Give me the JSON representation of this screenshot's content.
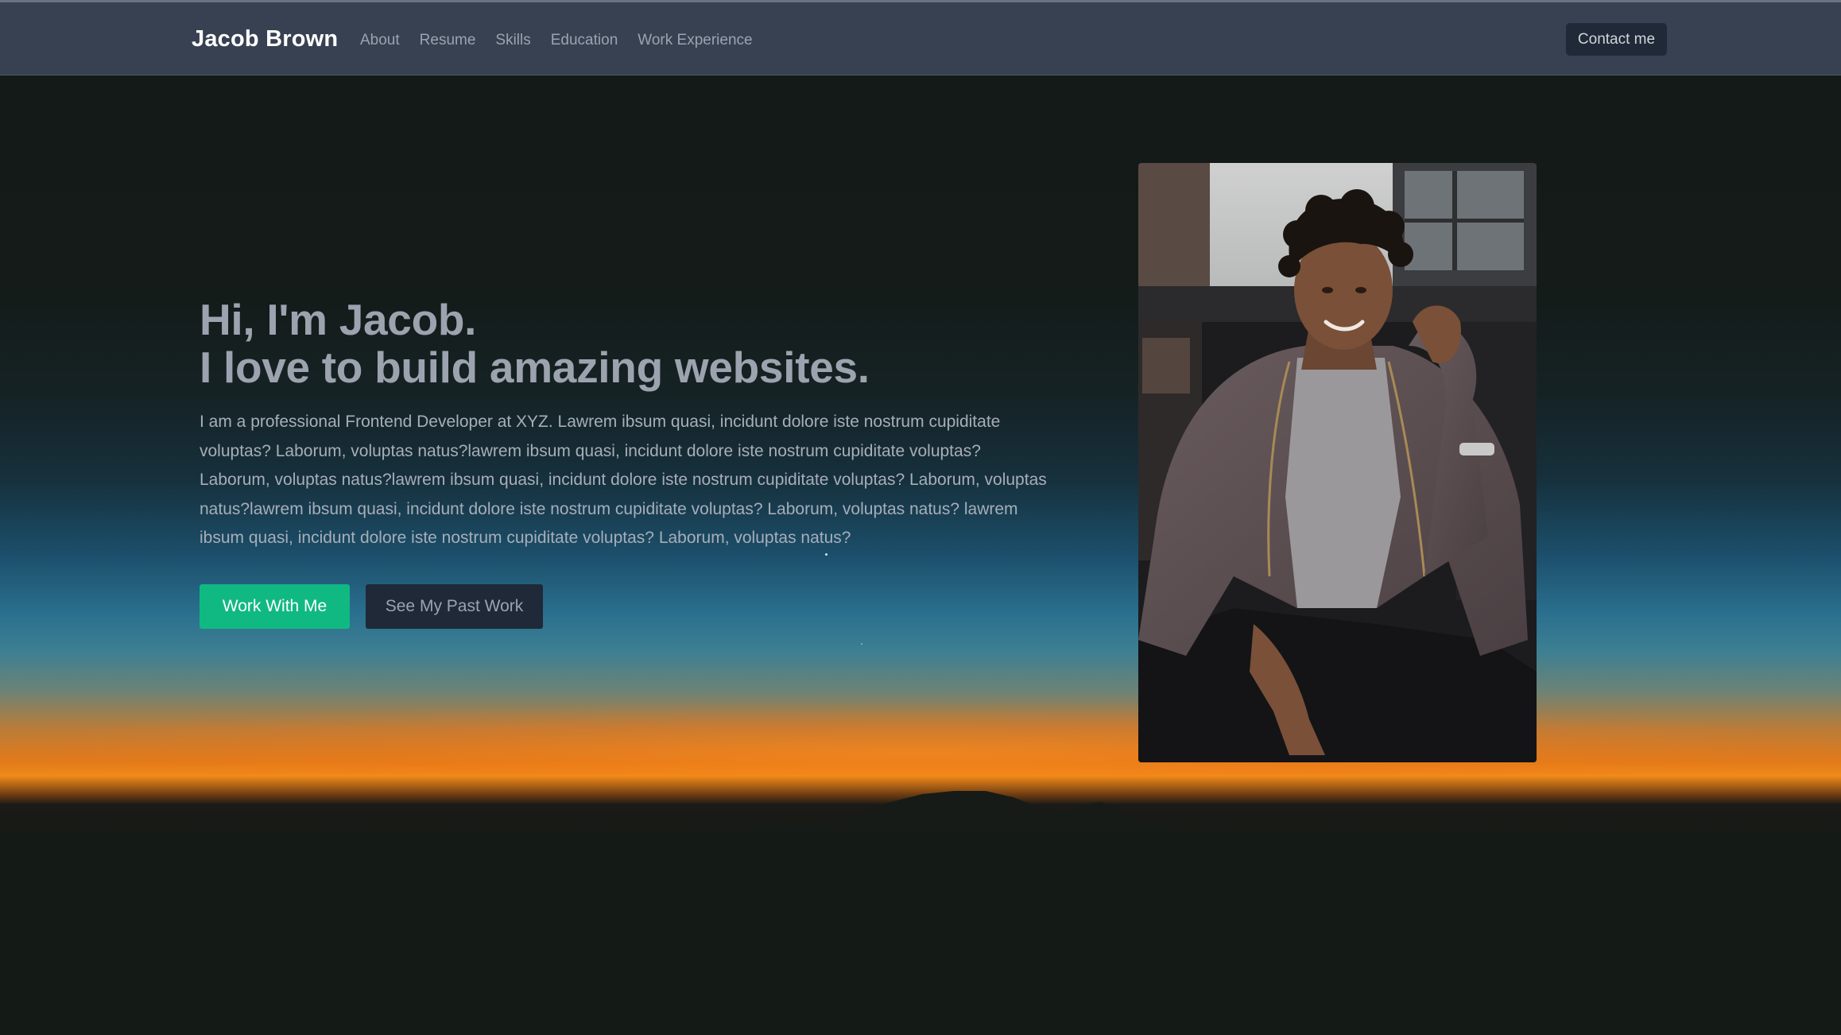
{
  "navbar": {
    "brand": "Jacob Brown",
    "links": [
      "About",
      "Resume",
      "Skills",
      "Education",
      "Work Experience"
    ],
    "contact_label": "Contact me"
  },
  "hero": {
    "headline_line1": "Hi, I'm Jacob.",
    "headline_line2": "I love to build amazing websites.",
    "intro": "I am a professional Frontend Developer at XYZ. Lawrem ibsum quasi, incidunt dolore iste nostrum cupiditate voluptas? Laborum, voluptas natus?lawrem ibsum quasi, incidunt dolore iste nostrum cupiditate voluptas? Laborum, voluptas natus?lawrem ibsum quasi, incidunt dolore iste nostrum cupiditate voluptas? Laborum, voluptas natus?lawrem ibsum quasi, incidunt dolore iste nostrum cupiditate voluptas? Laborum, voluptas natus? lawrem ibsum quasi, incidunt dolore iste nostrum cupiditate voluptas? Laborum, voluptas natus?",
    "primary_button": "Work With Me",
    "secondary_button": "See My Past Work"
  },
  "colors": {
    "navbar_bg": "#374151",
    "accent": "#10b981",
    "secondary_button_bg": "#1f2937",
    "headline": "#9ca3af"
  }
}
